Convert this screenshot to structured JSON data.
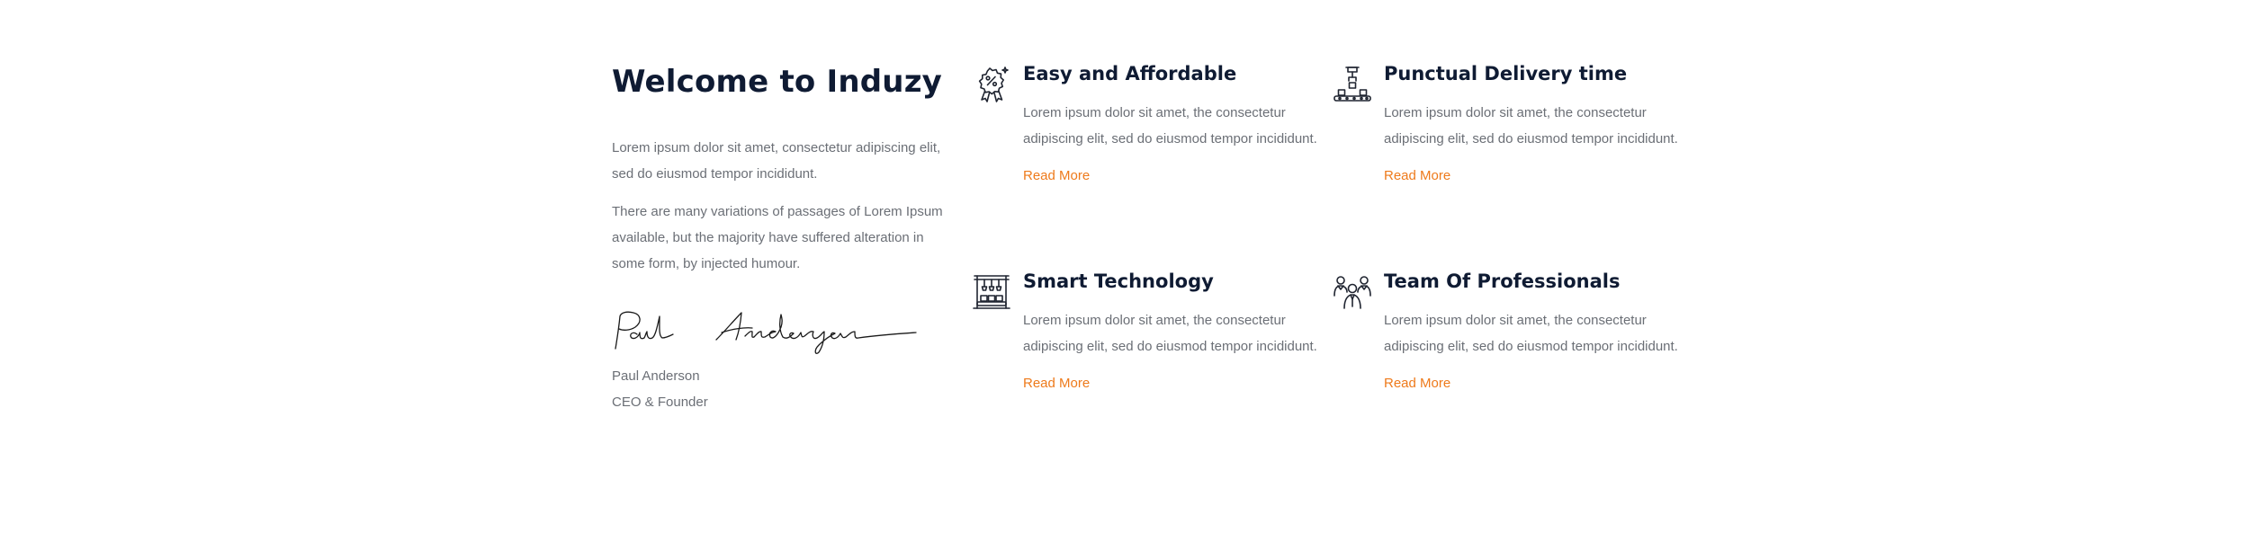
{
  "intro": {
    "title": "Welcome to Induzy",
    "paragraph1": "Lorem ipsum dolor sit amet, consectetur adipiscing elit, sed do eiusmod tempor incididunt.",
    "paragraph2": "There are many variations of passages of Lorem Ipsum available, but the majority have suffered alteration in some form, by injected humour.",
    "signature_text": "Paul Anderson",
    "name": "Paul Anderson",
    "role": "CEO & Founder"
  },
  "features": [
    {
      "icon": "discount-badge-icon",
      "title": "Easy and Affordable",
      "description": "Lorem ipsum dolor sit amet, the consectetur adipiscing elit, sed do eiusmod tempor incididunt.",
      "link": "Read More"
    },
    {
      "icon": "conveyor-boxes-icon",
      "title": "Punctual Delivery time",
      "description": "Lorem ipsum dolor sit amet, the consectetur adipiscing elit, sed do eiusmod tempor incididunt.",
      "link": "Read More"
    },
    {
      "icon": "robotic-factory-icon",
      "title": "Smart Technology",
      "description": "Lorem ipsum dolor sit amet, the consectetur adipiscing elit, sed do eiusmod tempor incididunt.",
      "link": "Read More"
    },
    {
      "icon": "team-group-icon",
      "title": "Team Of Professionals",
      "description": "Lorem ipsum dolor sit amet, the consectetur adipiscing elit, sed do eiusmod tempor incididunt.",
      "link": "Read More"
    }
  ],
  "colors": {
    "heading": "#0f1b33",
    "body_text": "#6b6f76",
    "accent": "#ee7a1b"
  }
}
